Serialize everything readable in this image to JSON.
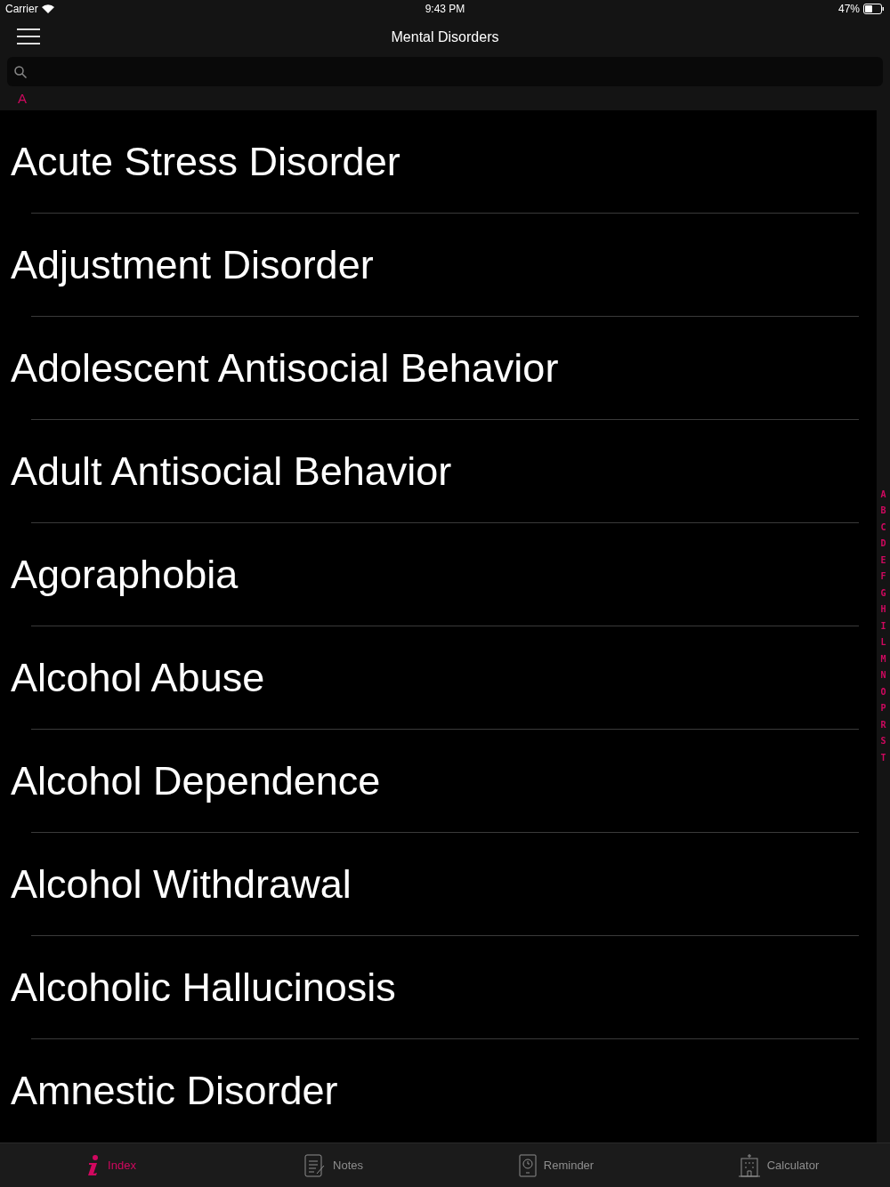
{
  "status_bar": {
    "carrier": "Carrier",
    "time": "9:43 PM",
    "battery": "47%"
  },
  "nav": {
    "title": "Mental Disorders"
  },
  "section": {
    "letter": "A"
  },
  "items": [
    "Acute Stress Disorder",
    "Adjustment Disorder",
    "Adolescent Antisocial Behavior",
    "Adult Antisocial Behavior",
    "Agoraphobia",
    "Alcohol Abuse",
    "Alcohol Dependence",
    "Alcohol Withdrawal",
    "Alcoholic Hallucinosis",
    "Amnestic Disorder"
  ],
  "index_letters": [
    "A",
    "B",
    "C",
    "D",
    "E",
    "F",
    "G",
    "H",
    "I",
    "L",
    "M",
    "N",
    "O",
    "P",
    "R",
    "S",
    "T"
  ],
  "tabs": [
    {
      "label": "Index",
      "kind": "info",
      "selected": true
    },
    {
      "label": "Notes",
      "kind": "notes",
      "selected": false
    },
    {
      "label": "Reminder",
      "kind": "reminder",
      "selected": false
    },
    {
      "label": "Calculator",
      "kind": "calculator",
      "selected": false
    }
  ]
}
